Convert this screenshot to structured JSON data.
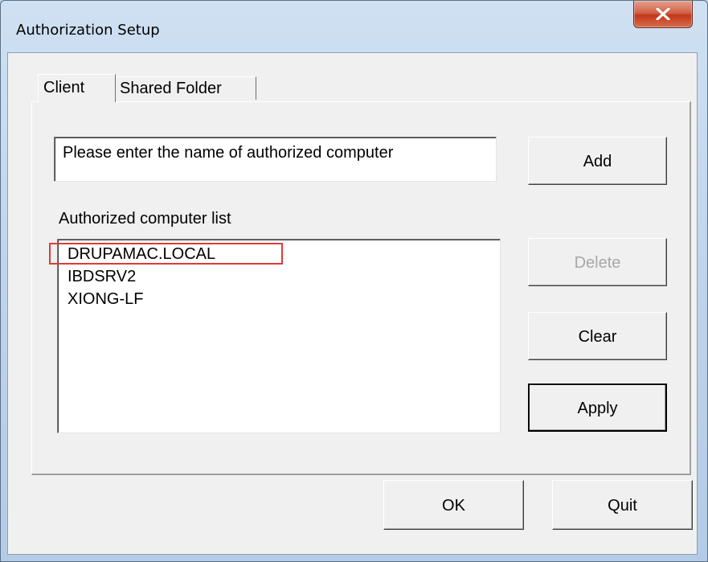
{
  "window": {
    "title": "Authorization Setup"
  },
  "tabs": [
    {
      "label": "Client",
      "active": true
    },
    {
      "label": "Shared Folder",
      "active": false
    }
  ],
  "client": {
    "input_value": "Please enter the name of authorized computer",
    "list_label": "Authorized computer list",
    "list_items": [
      "DRUPAMAC.LOCAL",
      "IBDSRV2",
      "XIONG-LF"
    ],
    "highlighted_item": "DRUPAMAC.LOCAL",
    "buttons": {
      "add": "Add",
      "delete": "Delete",
      "clear": "Clear",
      "apply": "Apply"
    },
    "delete_enabled": false
  },
  "footer": {
    "ok": "OK",
    "quit": "Quit"
  },
  "colors": {
    "highlight_outline": "#e03a3a",
    "close_button": "#c7432a",
    "disabled_text": "#a8a8a8"
  }
}
